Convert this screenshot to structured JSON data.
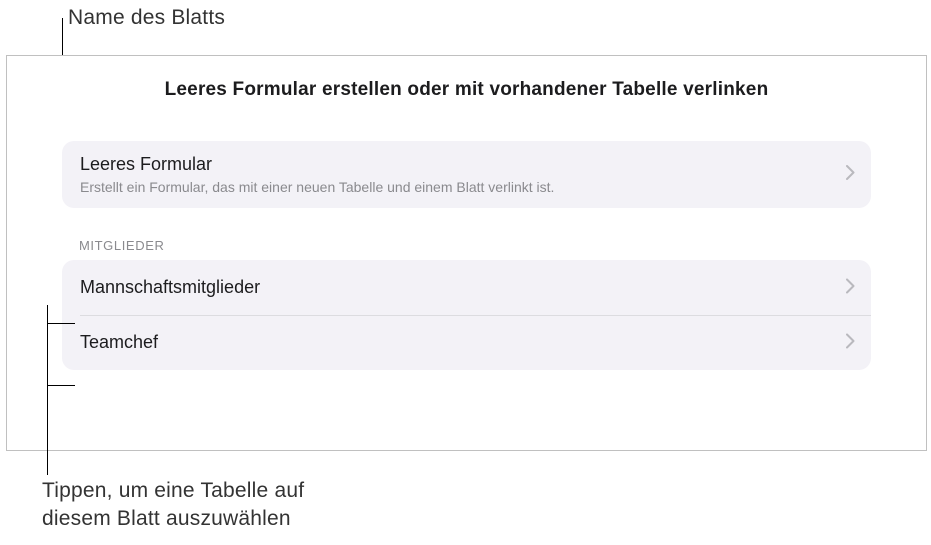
{
  "callouts": {
    "top": "Name des Blatts",
    "bottom_line1": "Tippen, um eine Tabelle auf",
    "bottom_line2": "diesem Blatt auszuwählen"
  },
  "panel": {
    "title": "Leeres Formular erstellen oder mit vorhandener Tabelle verlinken",
    "blank_form": {
      "title": "Leeres Formular",
      "subtitle": "Erstellt ein Formular, das mit einer neuen Tabelle und einem Blatt verlinkt ist."
    },
    "section_header": "MITGLIEDER",
    "tables": [
      {
        "label": "Mannschaftsmitglieder"
      },
      {
        "label": "Teamchef"
      }
    ]
  }
}
